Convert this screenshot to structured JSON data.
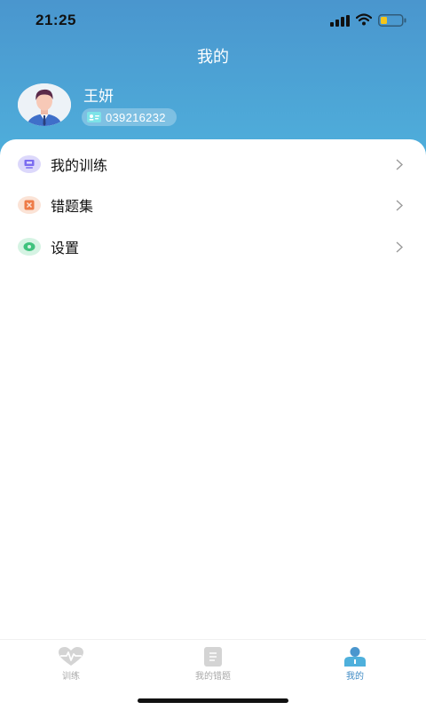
{
  "status_bar": {
    "time": "21:25"
  },
  "header": {
    "title": "我的"
  },
  "user": {
    "name": "王妍",
    "id": "039216232"
  },
  "menu": {
    "items": [
      {
        "label": "我的训练",
        "icon": "training-icon",
        "icon_bg": "#dcd8fb",
        "icon_color": "#7b6cf0"
      },
      {
        "label": "错题集",
        "icon": "error-book-icon",
        "icon_bg": "#fbe3d6",
        "icon_color": "#ee7c48"
      },
      {
        "label": "设置",
        "icon": "settings-icon",
        "icon_bg": "#d5f3e3",
        "icon_color": "#3fc27d"
      }
    ]
  },
  "tab_bar": {
    "tabs": [
      {
        "label": "训练",
        "icon": "heartbeat-icon",
        "active": false
      },
      {
        "label": "我的错题",
        "icon": "error-note-icon",
        "active": false
      },
      {
        "label": "我的",
        "icon": "user-icon",
        "active": true
      }
    ]
  },
  "colors": {
    "header_top": "#4a96ce",
    "header_bottom": "#4fb0dc",
    "active_tab": "#3e8ac4",
    "inactive_tab": "#a8a8a8"
  }
}
